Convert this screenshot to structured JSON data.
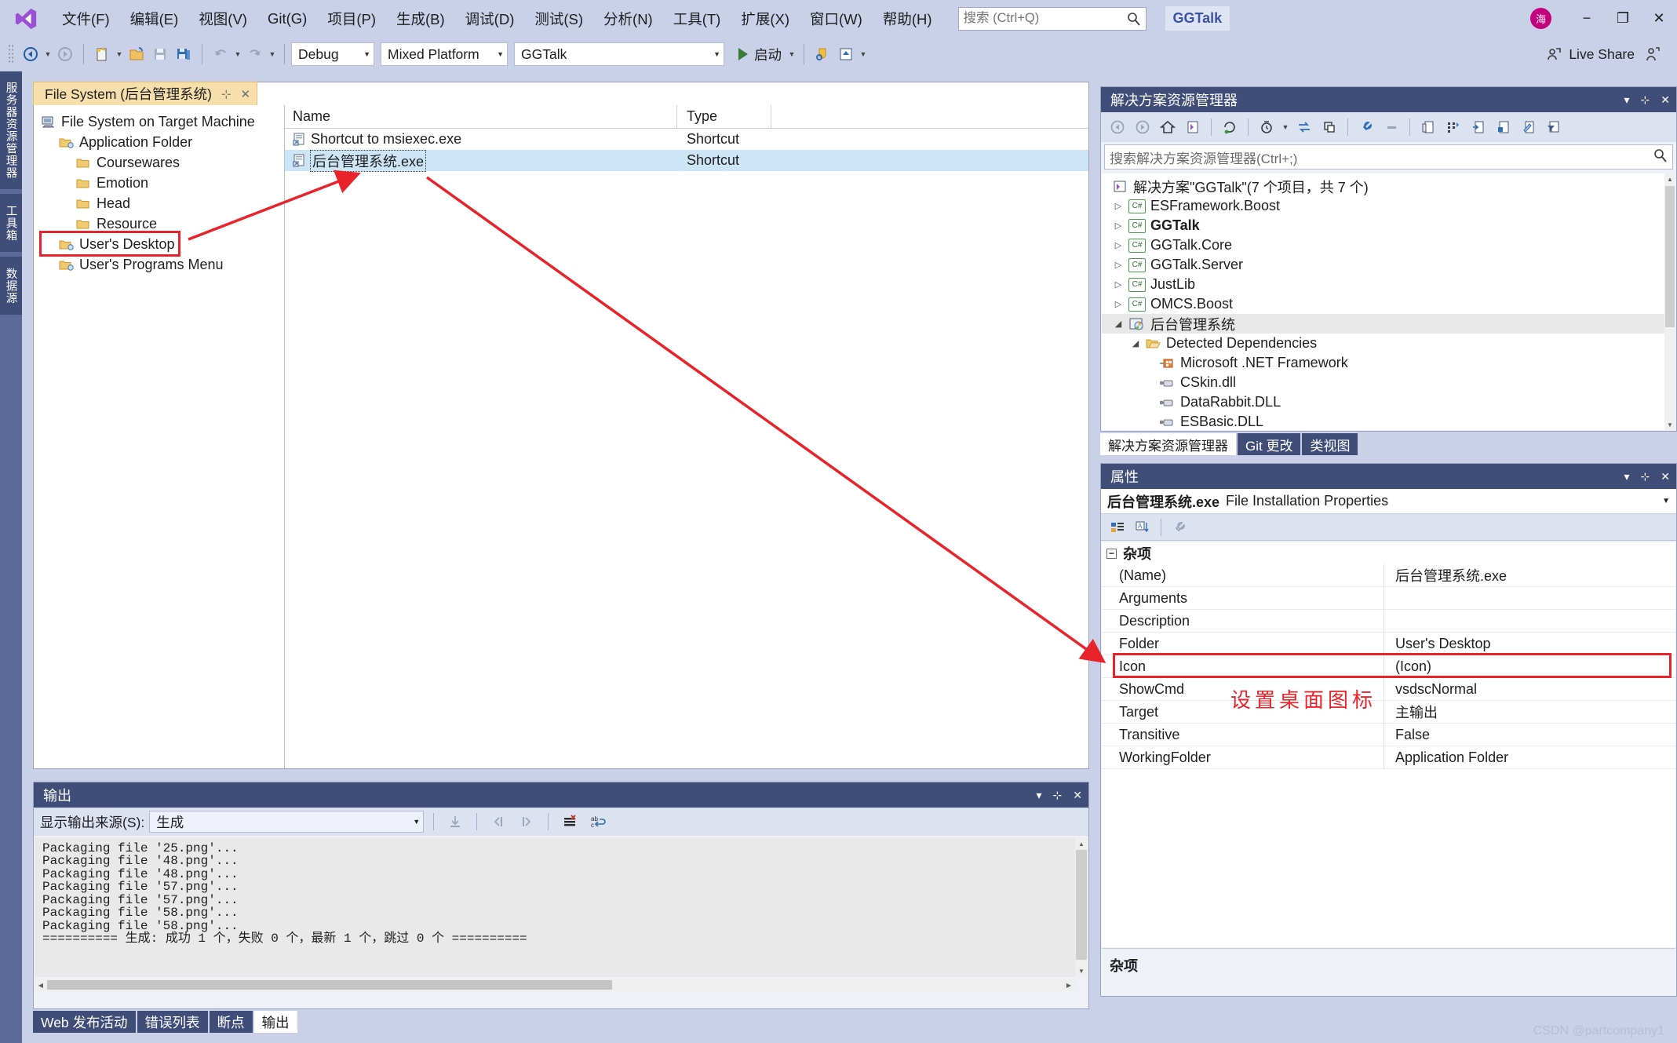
{
  "menu": {
    "logo": "vs-logo-icon",
    "items": [
      "文件(F)",
      "编辑(E)",
      "视图(V)",
      "Git(G)",
      "项目(P)",
      "生成(B)",
      "调试(D)",
      "测试(S)",
      "分析(N)",
      "工具(T)",
      "扩展(X)",
      "窗口(W)",
      "帮助(H)"
    ],
    "search_placeholder": "搜索 (Ctrl+Q)",
    "solution_chip": "GGTalk",
    "avatar_text": "海",
    "window_buttons": {
      "minimize": "−",
      "restore": "❐",
      "close": "✕"
    }
  },
  "toolbar": {
    "config": "Debug",
    "platform": "Mixed Platform",
    "startup_project": "GGTalk",
    "run_label": "启动",
    "live_share": "Live Share"
  },
  "leftdock": {
    "tabs": [
      "服务器资源管理器",
      "工具箱",
      "数据源"
    ]
  },
  "designer": {
    "tab_title": "File System (后台管理系统)",
    "tree": [
      {
        "label": "File System on Target Machine",
        "indent": 0,
        "icon": "computer-icon"
      },
      {
        "label": "Application Folder",
        "indent": 1,
        "icon": "special-folder-icon"
      },
      {
        "label": "Coursewares",
        "indent": 2,
        "icon": "folder-icon"
      },
      {
        "label": "Emotion",
        "indent": 2,
        "icon": "folder-icon"
      },
      {
        "label": "Head",
        "indent": 2,
        "icon": "folder-icon"
      },
      {
        "label": "Resource",
        "indent": 2,
        "icon": "folder-icon"
      },
      {
        "label": "User's Desktop",
        "indent": 1,
        "icon": "special-folder-icon"
      },
      {
        "label": "User's Programs Menu",
        "indent": 1,
        "icon": "special-folder-icon"
      }
    ],
    "columns": [
      "Name",
      "Type"
    ],
    "rows": [
      {
        "name": "Shortcut to msiexec.exe",
        "type": "Shortcut",
        "selected": false
      },
      {
        "name": "后台管理系统.exe",
        "type": "Shortcut",
        "selected": true
      }
    ]
  },
  "solution_explorer": {
    "title": "解决方案资源管理器",
    "search_placeholder": "搜索解决方案资源管理器(Ctrl+;)",
    "root": "解决方案\"GGTalk\"(7 个项目，共 7 个)",
    "nodes": [
      {
        "label": "ESFramework.Boost",
        "indent": 1,
        "icon": "csharp-project-icon",
        "expander": "▷",
        "bold": false
      },
      {
        "label": "GGTalk",
        "indent": 1,
        "icon": "csharp-project-icon",
        "expander": "▷",
        "bold": true
      },
      {
        "label": "GGTalk.Core",
        "indent": 1,
        "icon": "csharp-project-icon",
        "expander": "▷",
        "bold": false
      },
      {
        "label": "GGTalk.Server",
        "indent": 1,
        "icon": "csharp-project-icon",
        "expander": "▷",
        "bold": false
      },
      {
        "label": "JustLib",
        "indent": 1,
        "icon": "csharp-project-icon",
        "expander": "▷",
        "bold": false
      },
      {
        "label": "OMCS.Boost",
        "indent": 1,
        "icon": "csharp-project-icon",
        "expander": "▷",
        "bold": false
      },
      {
        "label": "后台管理系统",
        "indent": 1,
        "icon": "setup-project-icon",
        "expander": "◢",
        "bold": false,
        "highlight": true
      },
      {
        "label": "Detected Dependencies",
        "indent": 2,
        "icon": "folder-open-icon",
        "expander": "◢",
        "bold": false
      },
      {
        "label": "Microsoft .NET Framework",
        "indent": 3,
        "icon": "framework-ref-icon",
        "expander": "",
        "bold": false
      },
      {
        "label": "CSkin.dll",
        "indent": 3,
        "icon": "dll-ref-icon",
        "expander": "",
        "bold": false
      },
      {
        "label": "DataRabbit.DLL",
        "indent": 3,
        "icon": "dll-ref-icon",
        "expander": "",
        "bold": false
      },
      {
        "label": "ESBasic.DLL",
        "indent": 3,
        "icon": "dll-ref-icon",
        "expander": "",
        "bold": false
      }
    ],
    "tabs": [
      {
        "label": "解决方案资源管理器",
        "active": true
      },
      {
        "label": "Git 更改",
        "active": false
      },
      {
        "label": "类视图",
        "active": false
      }
    ]
  },
  "properties": {
    "title": "属性",
    "object_name": "后台管理系统.exe",
    "object_kind": "File Installation Properties",
    "category": "杂项",
    "rows": [
      {
        "key": "(Name)",
        "value": "后台管理系统.exe",
        "highlight": false
      },
      {
        "key": "Arguments",
        "value": "",
        "highlight": false
      },
      {
        "key": "Description",
        "value": "",
        "highlight": false
      },
      {
        "key": "Folder",
        "value": "User's Desktop",
        "highlight": false
      },
      {
        "key": "Icon",
        "value": "(Icon)",
        "highlight": true
      },
      {
        "key": "ShowCmd",
        "value": "vsdscNormal",
        "highlight": false
      },
      {
        "key": "Target",
        "value": "主输出",
        "highlight": false
      },
      {
        "key": "Transitive",
        "value": "False",
        "highlight": false
      },
      {
        "key": "WorkingFolder",
        "value": "Application Folder",
        "highlight": false
      }
    ],
    "footer": "杂项"
  },
  "output": {
    "title": "输出",
    "source_label": "显示输出来源(S):",
    "source_value": "生成",
    "lines": [
      "Packaging file '25.png'...",
      "Packaging file '48.png'...",
      "Packaging file '48.png'...",
      "Packaging file '57.png'...",
      "Packaging file '57.png'...",
      "Packaging file '58.png'...",
      "Packaging file '58.png'...",
      "========== 生成: 成功 1 个，失败 0 个，最新 1 个，跳过 0 个 =========="
    ],
    "tabs": [
      {
        "label": "Web 发布活动",
        "active": false
      },
      {
        "label": "错误列表",
        "active": false
      },
      {
        "label": "断点",
        "active": false
      },
      {
        "label": "输出",
        "active": true
      }
    ]
  },
  "annotations": {
    "note_text": "设置桌面图标",
    "accent_red": "#e8232a"
  },
  "watermark": "CSDN @partcompany1"
}
